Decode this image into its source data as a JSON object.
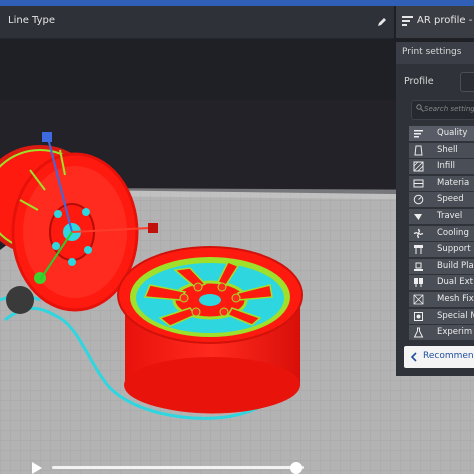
{
  "viewport": {
    "toolbar": {
      "view_mode": "Line Type",
      "edit_icon": "pencil-icon"
    }
  },
  "print_panel": {
    "header": {
      "icon": "printer-settings-icon",
      "label": "AR profile - Su"
    },
    "title": "Print settings",
    "profile_label": "Profile",
    "search_placeholder": "Search settings",
    "categories": [
      {
        "label": "Quality",
        "icon": "quality-icon"
      },
      {
        "label": "Shell",
        "icon": "shell-icon"
      },
      {
        "label": "Infill",
        "icon": "infill-icon"
      },
      {
        "label": "Materia",
        "icon": "material-icon"
      },
      {
        "label": "Speed",
        "icon": "speed-icon"
      },
      {
        "label": "Travel",
        "icon": "travel-icon"
      },
      {
        "label": "Cooling",
        "icon": "cooling-icon"
      },
      {
        "label": "Support",
        "icon": "support-icon"
      },
      {
        "label": "Build Pla",
        "icon": "build-plate-icon"
      },
      {
        "label": "Dual Ext",
        "icon": "dual-extrusion-icon"
      },
      {
        "label": "Mesh Fix",
        "icon": "mesh-fixes-icon"
      },
      {
        "label": "Special M",
        "icon": "special-modes-icon"
      },
      {
        "label": "Experim",
        "icon": "experimental-icon"
      }
    ],
    "recommended_button": "Recommend"
  },
  "layer_slider": {
    "progress": 0.97,
    "play_icon": "play-icon"
  },
  "colors": {
    "model_red": "#ff1a10",
    "inner_wall_green": "#9fe02a",
    "support_cyan": "#2ed6e0",
    "build_plate": "#b4b4b4",
    "panel_bg": "#2f3238",
    "accent_blue": "#1f4fa0"
  }
}
